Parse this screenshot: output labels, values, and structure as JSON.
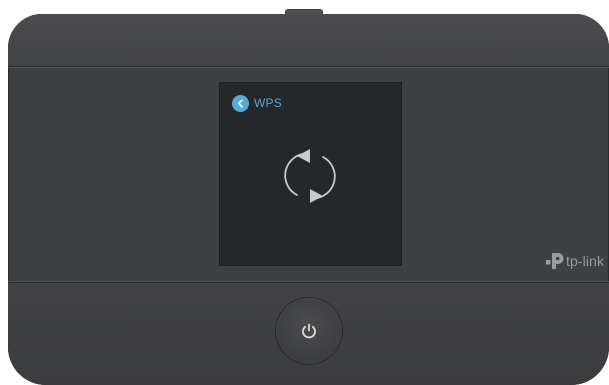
{
  "screen": {
    "back_icon": "chevron-left-icon",
    "title": "WPS",
    "status_icon": "sync-icon",
    "accent_color": "#5aa8d6"
  },
  "device": {
    "brand": "tp-link",
    "brand_icon": "tp-link-logo-icon",
    "power_icon": "power-icon",
    "body_color": "#3f4042",
    "screen_color": "#262728"
  }
}
